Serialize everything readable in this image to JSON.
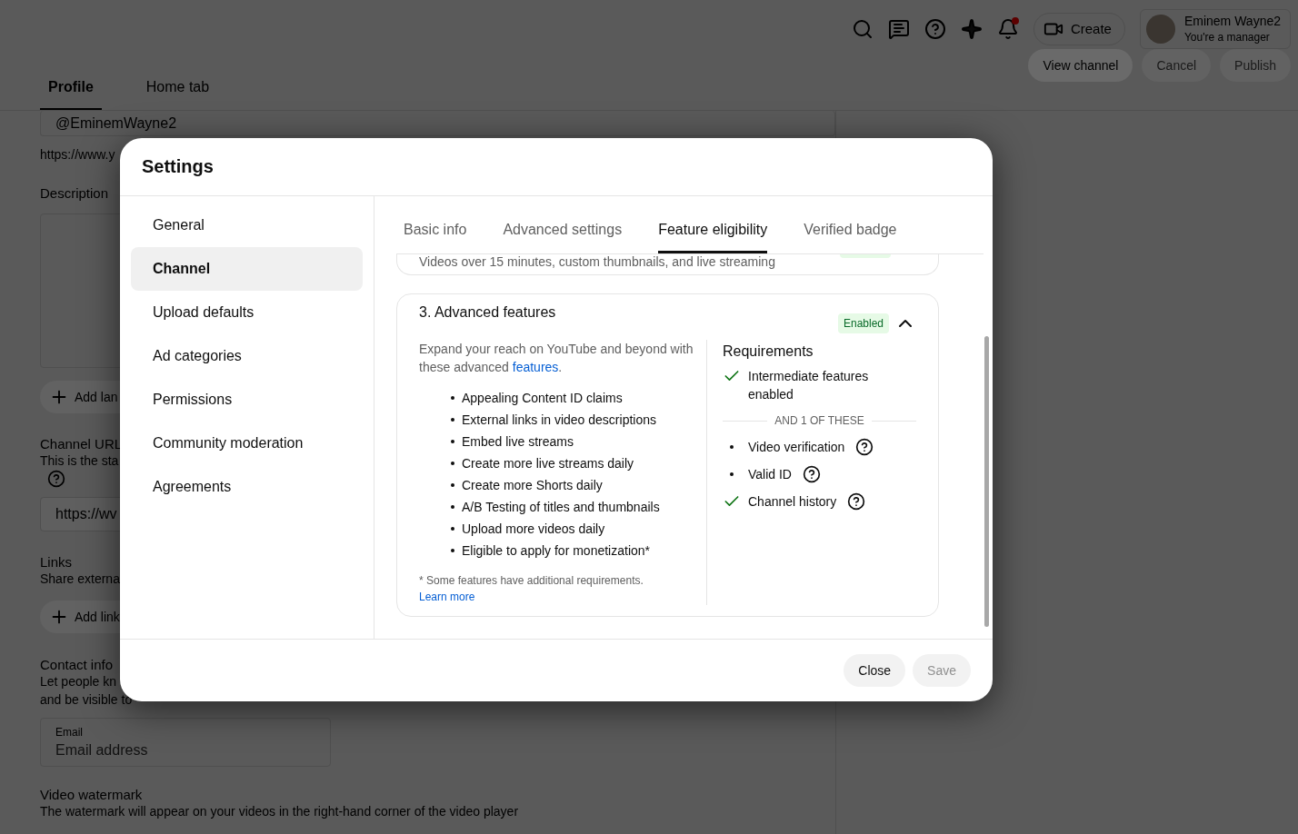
{
  "topbar": {
    "create_label": "Create",
    "account": {
      "name": "Eminem Wayne2",
      "role": "You're a manager"
    }
  },
  "page_tabs": [
    {
      "label": "Profile",
      "selected": true
    },
    {
      "label": "Home tab",
      "selected": false
    }
  ],
  "page_actions": [
    {
      "label": "View channel",
      "disabled": false
    },
    {
      "label": "Cancel",
      "disabled": true
    },
    {
      "label": "Publish",
      "disabled": true
    }
  ],
  "profile_form": {
    "handle": "@EminemWayne2",
    "handle_url": "https://www.y",
    "description_label": "Description",
    "add_language": "Add lan",
    "channel_url_label": "Channel URL",
    "channel_url_hint": "This is the sta",
    "channel_url_value": "https://wv",
    "links_label": "Links",
    "links_hint": "Share externa",
    "add_link": "Add link",
    "contact_label": "Contact info",
    "contact_hint": [
      "Let people kn",
      "and be visible to"
    ],
    "email_label": "Email",
    "email_placeholder": "Email address",
    "watermark_label": "Video watermark",
    "watermark_hint": "The watermark will appear on your videos in the right-hand corner of the video player"
  },
  "dialog": {
    "title": "Settings",
    "nav": [
      {
        "label": "General",
        "selected": false
      },
      {
        "label": "Channel",
        "selected": true
      },
      {
        "label": "Upload defaults",
        "selected": false
      },
      {
        "label": "Ad categories",
        "selected": false
      },
      {
        "label": "Permissions",
        "selected": false
      },
      {
        "label": "Community moderation",
        "selected": false
      },
      {
        "label": "Agreements",
        "selected": false
      }
    ],
    "tabs": [
      {
        "label": "Basic info",
        "selected": false
      },
      {
        "label": "Advanced settings",
        "selected": false
      },
      {
        "label": "Feature eligibility",
        "selected": true
      },
      {
        "label": "Verified badge",
        "selected": false
      }
    ],
    "previous_card": {
      "text": "Videos over 15 minutes, custom thumbnails, and live streaming"
    },
    "card": {
      "title": "3. Advanced features",
      "status": "Enabled",
      "expanded": true,
      "description": {
        "before": "Expand your reach on YouTube and beyond with these advanced ",
        "link": "features",
        "after": "."
      },
      "features": [
        "Appealing Content ID claims",
        "External links in video descriptions",
        "Embed live streams",
        "Create more live streams daily",
        "Create more Shorts daily",
        "A/B Testing of titles and thumbnails",
        "Upload more videos daily",
        "Eligible to apply for monetization*"
      ],
      "footnote": {
        "text": "* Some features have additional requirements.",
        "link": "Learn more"
      },
      "requirements_title": "Requirements",
      "requirements": [
        {
          "text": "Intermediate features enabled",
          "met": true
        }
      ],
      "divider": "AND 1 OF THESE",
      "options": [
        {
          "text": "Video verification",
          "met": false
        },
        {
          "text": "Valid ID",
          "met": false
        },
        {
          "text": "Channel history",
          "met": true
        }
      ]
    },
    "buttons": [
      {
        "label": "Close",
        "disabled": false
      },
      {
        "label": "Save",
        "disabled": true
      }
    ]
  }
}
